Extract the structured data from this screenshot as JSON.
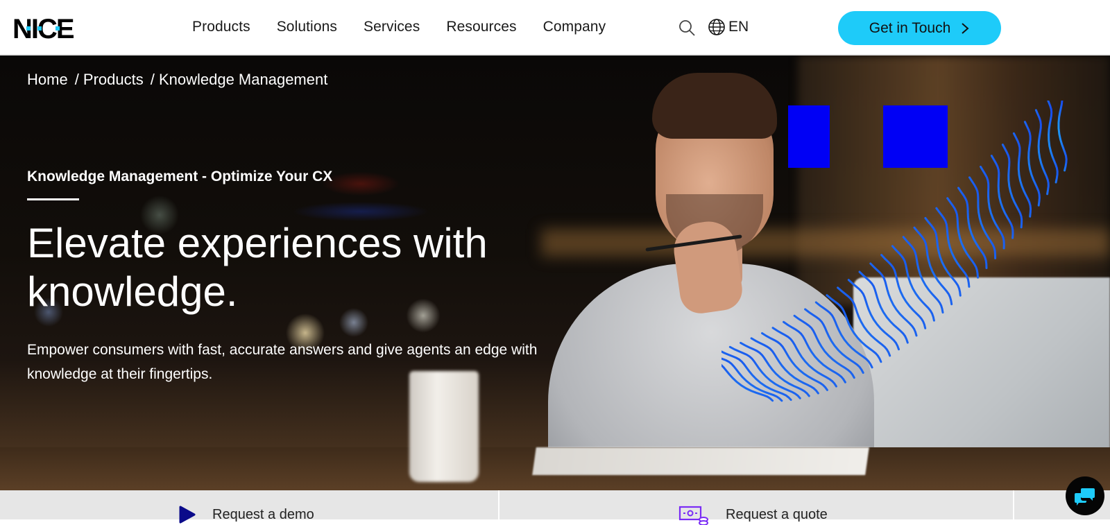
{
  "brand": {
    "name": "NICE",
    "accent_color": "#1ecbf9",
    "dots_color": "#1ecbf9"
  },
  "nav": {
    "items": [
      {
        "label": "Products"
      },
      {
        "label": "Solutions"
      },
      {
        "label": "Services"
      },
      {
        "label": "Resources"
      },
      {
        "label": "Company"
      }
    ],
    "search_icon": "search-icon",
    "language": {
      "icon": "globe-icon",
      "label": "EN"
    },
    "cta": {
      "label": "Get in Touch",
      "icon": "chevron-right-icon",
      "color": "#1ecbf9"
    }
  },
  "hero": {
    "breadcrumb": [
      {
        "label": "Home"
      },
      {
        "label": "/ Products"
      },
      {
        "label": "/ Knowledge Management"
      }
    ],
    "eyebrow": "Knowledge Management - Optimize Your CX",
    "headline": "Elevate experiences with knowledge.",
    "subtext": "Empower consumers with fast, accurate answers and give agents an edge with knowledge at their fingertips.",
    "decor_color": "#0000f5"
  },
  "bottom_bar": {
    "items": [
      {
        "label": "Request a demo",
        "icon": "play-icon",
        "icon_color": "#0b0b8a"
      },
      {
        "label": "Request a quote",
        "icon": "quote-money-icon",
        "icon_color": "#7a2cf5"
      },
      {
        "label": ""
      }
    ]
  },
  "chat": {
    "icon": "chat-bubbles-icon",
    "color": "#1ecbf9"
  }
}
